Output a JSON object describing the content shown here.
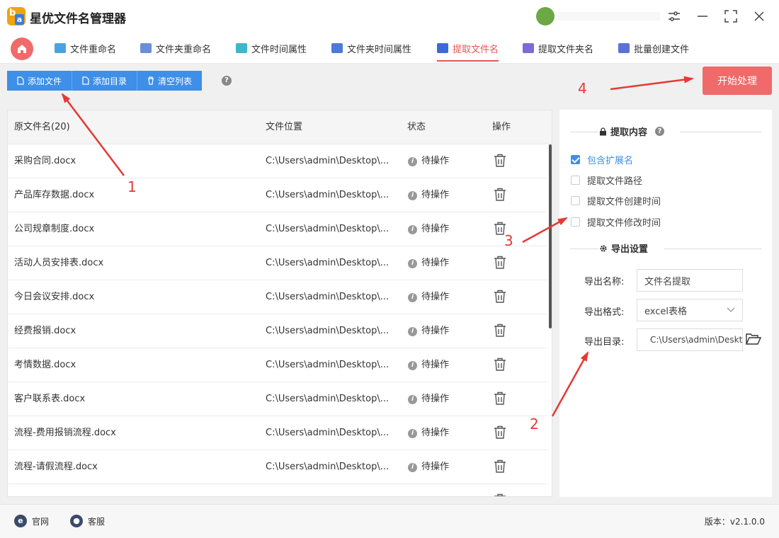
{
  "app": {
    "title": "星优文件名管理器"
  },
  "tabs": [
    {
      "label": "文件重命名",
      "icon": "rename-file-icon",
      "color": "#4aa3df"
    },
    {
      "label": "文件夹重命名",
      "icon": "rename-folder-icon",
      "color": "#6b8fd6"
    },
    {
      "label": "文件时间属性",
      "icon": "file-time-icon",
      "color": "#3fb6c9"
    },
    {
      "label": "文件夹时间属性",
      "icon": "folder-time-icon",
      "color": "#4b7bd6"
    },
    {
      "label": "提取文件名",
      "icon": "extract-filename-icon",
      "color": "#3d6ad6"
    },
    {
      "label": "提取文件夹名",
      "icon": "extract-foldername-icon",
      "color": "#7a6bd6"
    },
    {
      "label": "批量创建文件",
      "icon": "batch-create-icon",
      "color": "#5a72d6"
    }
  ],
  "toolbar": {
    "add_file": "添加文件",
    "add_dir": "添加目录",
    "clear_list": "清空列表",
    "help": "?"
  },
  "start_button": "开始处理",
  "table": {
    "headers": {
      "name": "原文件名(20)",
      "location": "文件位置",
      "status": "状态",
      "action": "操作"
    },
    "rows": [
      {
        "name": "采购合同.docx",
        "location": "C:\\Users\\admin\\Desktop\\...",
        "status": "待操作"
      },
      {
        "name": "产品库存数据.docx",
        "location": "C:\\Users\\admin\\Desktop\\...",
        "status": "待操作"
      },
      {
        "name": "公司规章制度.docx",
        "location": "C:\\Users\\admin\\Desktop\\...",
        "status": "待操作"
      },
      {
        "name": "活动人员安排表.docx",
        "location": "C:\\Users\\admin\\Desktop\\...",
        "status": "待操作"
      },
      {
        "name": "今日会议安排.docx",
        "location": "C:\\Users\\admin\\Desktop\\...",
        "status": "待操作"
      },
      {
        "name": "经费报销.docx",
        "location": "C:\\Users\\admin\\Desktop\\...",
        "status": "待操作"
      },
      {
        "name": "考情数据.docx",
        "location": "C:\\Users\\admin\\Desktop\\...",
        "status": "待操作"
      },
      {
        "name": "客户联系表.docx",
        "location": "C:\\Users\\admin\\Desktop\\...",
        "status": "待操作"
      },
      {
        "name": "流程-费用报销流程.docx",
        "location": "C:\\Users\\admin\\Desktop\\...",
        "status": "待操作"
      },
      {
        "name": "流程-请假流程.docx",
        "location": "C:\\Users\\admin\\Desktop\\...",
        "status": "待操作"
      }
    ]
  },
  "panel": {
    "extract_title": "提取内容",
    "options": [
      {
        "label": "包含扩展名",
        "checked": true
      },
      {
        "label": "提取文件路径",
        "checked": false
      },
      {
        "label": "提取文件创建时间",
        "checked": false
      },
      {
        "label": "提取文件修改时间",
        "checked": false
      }
    ],
    "export_title": "导出设置",
    "export_name_label": "导出名称:",
    "export_name_value": "文件名提取",
    "export_format_label": "导出格式:",
    "export_format_value": "excel表格",
    "export_dir_label": "导出目录:",
    "export_dir_value": "C:\\Users\\admin\\Desktop"
  },
  "footer": {
    "website": "官网",
    "support": "客服",
    "version": "版本：v2.1.0.0"
  },
  "annotations": {
    "a1": "1",
    "a2": "2",
    "a3": "3",
    "a4": "4"
  },
  "colors": {
    "accent_red": "#f06a6a",
    "accent_blue": "#3d8fe8",
    "annotation": "#e53935"
  }
}
